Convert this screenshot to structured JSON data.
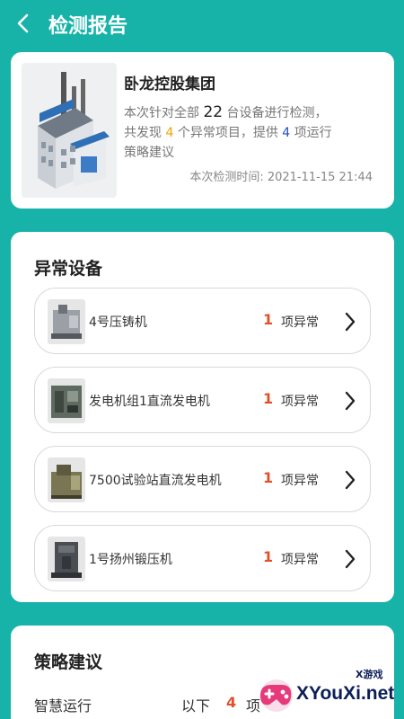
{
  "header": {
    "title": "检测报告"
  },
  "summary": {
    "company": "卧龙控股集团",
    "line1_pre": "本次针对全部",
    "device_total": "22",
    "line1_post": "台设备进行检测，",
    "line2_pre": "共发现",
    "abnormal_items": "4",
    "line2_mid": "个异常项目，提供",
    "strategy_count": "4",
    "line2_post": "项运行",
    "line3": "策略建议",
    "time_label": "本次检测时间:",
    "time_value": "2021-11-15 21:44"
  },
  "abnormal": {
    "title": "异常设备",
    "items": [
      {
        "name": "4号压铸机",
        "count": "1",
        "unit": "项异常"
      },
      {
        "name": "发电机组1直流发电机",
        "count": "1",
        "unit": "项异常"
      },
      {
        "name": "7500试验站直流发电机",
        "count": "1",
        "unit": "项异常"
      },
      {
        "name": "1号扬州锻压机",
        "count": "1",
        "unit": "项异常"
      }
    ]
  },
  "strategy": {
    "title": "策略建议",
    "row": {
      "label": "智慧运行",
      "pre": "以下",
      "num": "4",
      "post": "项"
    }
  },
  "watermark": {
    "text": "XYouXi.net",
    "sub": "X游戏"
  }
}
